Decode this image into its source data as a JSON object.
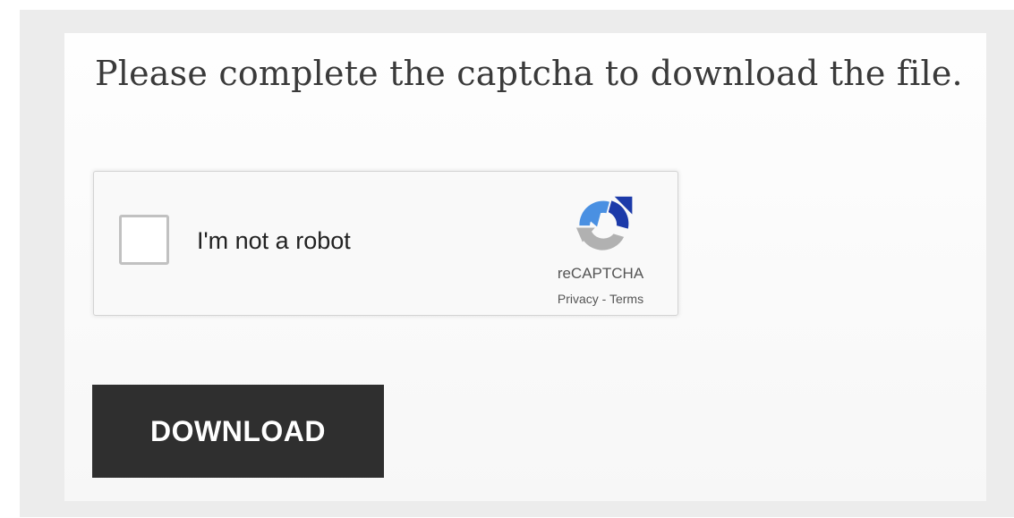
{
  "heading": "Please complete the captcha to download the file.",
  "recaptcha": {
    "checkbox_label": "I'm not a robot",
    "checked": false,
    "brand": "reCAPTCHA",
    "privacy_label": "Privacy",
    "separator": " - ",
    "terms_label": "Terms",
    "logo_icon": "recaptcha-logo-icon"
  },
  "download_button": {
    "label": "DOWNLOAD"
  },
  "colors": {
    "button_background": "#2f2f2f",
    "recaptcha_blue": "#4a90e2",
    "recaptcha_dark_blue": "#1c3aa9",
    "recaptcha_gray": "#b1b1b1"
  }
}
